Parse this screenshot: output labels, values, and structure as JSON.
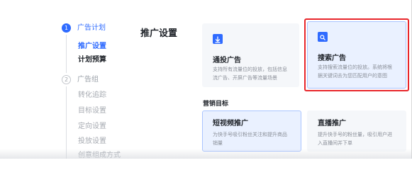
{
  "nav": {
    "step1": {
      "number": "1",
      "title": "广告计划"
    },
    "step1_items": [
      "推广设置",
      "计划预算"
    ],
    "step2": {
      "number": "2",
      "title": "广告组"
    },
    "step2_items": [
      "转化追踪",
      "目标设置",
      "定向设置",
      "投放设置",
      "创意组成方式"
    ]
  },
  "section": {
    "title": "推广设置"
  },
  "promo_cards": [
    {
      "title": "通投广告",
      "desc": "支持所有流量位的投放，包括信息\n流广告、开屏广告等流量场景"
    },
    {
      "title": "搜索广告",
      "desc": "支持搜索流量位的投放。系统将根\n据关键词去为您匹配用户的意图"
    }
  ],
  "marketing": {
    "label": "营销目标",
    "cards": [
      {
        "title": "短视频推广",
        "desc": "为快手号吸引粉丝关注和提升商品\n销量"
      },
      {
        "title": "直播推广",
        "desc": "提升快手号的粉丝量，吸引用户进\n入直播间并下单"
      }
    ]
  },
  "colors": {
    "accent": "#2f6bff",
    "highlight": "#e8262b",
    "card_bg": "#f5f7fa",
    "selected_bg": "#eaf1ff"
  },
  "icons": {
    "general": "download-arrow-icon",
    "search": "search-doc-icon"
  }
}
